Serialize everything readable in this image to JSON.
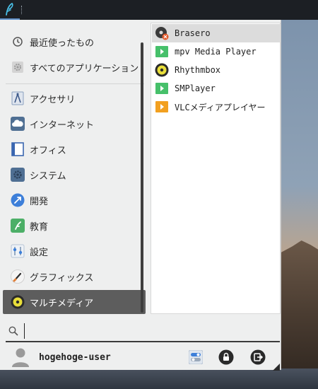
{
  "top_panel": {
    "launcher_icon": "whisker-menu-icon"
  },
  "categories": {
    "items": [
      {
        "label": "最近使ったもの",
        "icon": "recent-clock-icon"
      },
      {
        "label": "すべてのアプリケーション",
        "icon": "all-apps-gear-icon"
      },
      {
        "label": "アクセサリ",
        "icon": "accessories-compass-icon"
      },
      {
        "label": "インターネット",
        "icon": "internet-cloud-icon"
      },
      {
        "label": "オフィス",
        "icon": "office-document-icon"
      },
      {
        "label": "システム",
        "icon": "system-gear-icon"
      },
      {
        "label": "開発",
        "icon": "development-icon"
      },
      {
        "label": "教育",
        "icon": "education-icon"
      },
      {
        "label": "設定",
        "icon": "settings-icon"
      },
      {
        "label": "グラフィックス",
        "icon": "graphics-brush-icon"
      },
      {
        "label": "マルチメディア",
        "icon": "multimedia-speaker-icon"
      }
    ],
    "active": "マルチメディア"
  },
  "apps": {
    "items": [
      {
        "label": "Brasero",
        "icon": "brasero-disc-icon"
      },
      {
        "label": "mpv Media Player",
        "icon": "mpv-play-icon"
      },
      {
        "label": "Rhythmbox",
        "icon": "rhythmbox-speaker-icon"
      },
      {
        "label": "SMPlayer",
        "icon": "smplayer-play-icon"
      },
      {
        "label": "VLCメディアプレイヤー",
        "icon": "vlc-play-icon"
      }
    ],
    "highlighted": "Brasero"
  },
  "search": {
    "value": "",
    "placeholder": ""
  },
  "user": {
    "name": "hogehoge-user",
    "actions": [
      {
        "name": "settings-toggle-icon"
      },
      {
        "name": "lock-screen-icon"
      },
      {
        "name": "log-out-icon"
      }
    ]
  },
  "colors": {
    "menu_bg": "#eeefef",
    "active_category": "#5d5d5d",
    "highlight_app": "#dcdcdc",
    "panel": "#1c1f24",
    "accent": "#5f8fc8"
  }
}
